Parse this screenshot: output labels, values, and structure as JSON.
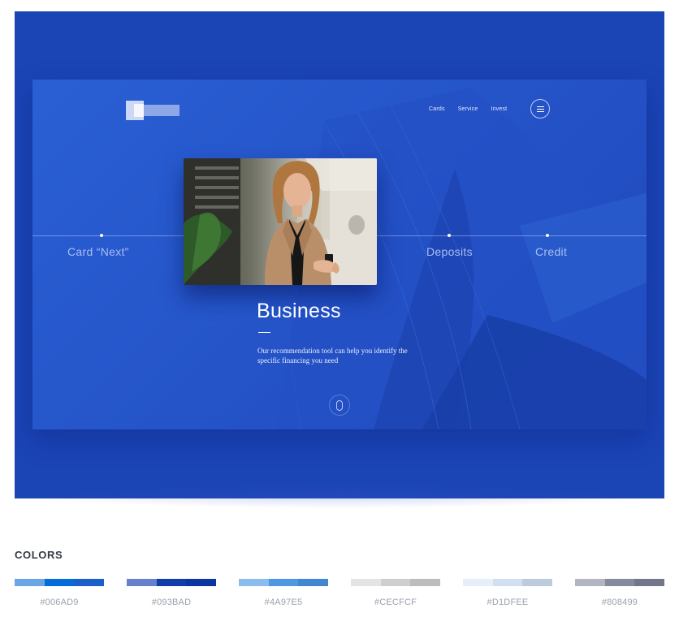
{
  "hero": {
    "nav": [
      "Cards",
      "Service",
      "Invest"
    ],
    "timeline": [
      "Card “Next”",
      "Deposits",
      "Credit"
    ],
    "title": "Business",
    "description": "Our recommendation tool can help you identify the specific financing you need",
    "background_color": "#1b44b5",
    "accent_color": "#2a5fd4"
  },
  "palette": {
    "heading": "COLORS",
    "swatches": [
      {
        "label": "#006AD9",
        "colors": [
          "#6aa6e6",
          "#066cd8",
          "#1a5fcc"
        ]
      },
      {
        "label": "#093BAD",
        "colors": [
          "#6680cc",
          "#0f3eac",
          "#0b35a0"
        ]
      },
      {
        "label": "#4A97E5",
        "colors": [
          "#8bbcee",
          "#4d97e4",
          "#4187d2"
        ]
      },
      {
        "label": "#CECFCF",
        "colors": [
          "#e3e4e4",
          "#cfcfcf",
          "#bdbdbd"
        ]
      },
      {
        "label": "#D1DFEE",
        "colors": [
          "#e6eef7",
          "#d2dfee",
          "#bdcbdc"
        ]
      },
      {
        "label": "#808499",
        "colors": [
          "#b3b5c2",
          "#858a9d",
          "#737789"
        ]
      }
    ]
  }
}
